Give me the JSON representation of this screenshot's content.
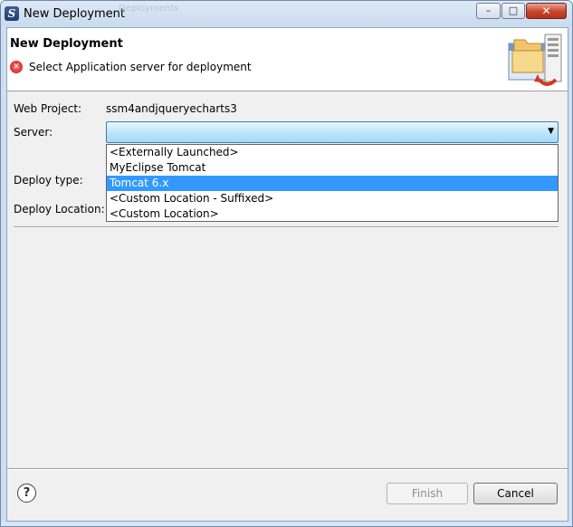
{
  "window": {
    "title": "New Deployment",
    "ghost_title": "Deployments",
    "minimize_symbol": "–",
    "maximize_symbol": "□",
    "close_symbol": "✕"
  },
  "header": {
    "title": "New Deployment",
    "message": "Select Application server for deployment",
    "message_icon": "error-icon"
  },
  "form": {
    "web_project_label": "Web Project:",
    "web_project_value": "ssm4andjqueryecharts3",
    "server_label": "Server:",
    "server_value": "",
    "deploy_type_label": "Deploy type:",
    "deploy_location_label": "Deploy Location:"
  },
  "server_dropdown": {
    "options": [
      "<Externally Launched>",
      "MyEclipse Tomcat",
      "Tomcat  6.x",
      "<Custom Location - Suffixed>",
      "<Custom Location>"
    ],
    "highlighted_option": "Tomcat  6.x"
  },
  "footer": {
    "help_symbol": "?",
    "finish_label": "Finish",
    "cancel_label": "Cancel"
  }
}
